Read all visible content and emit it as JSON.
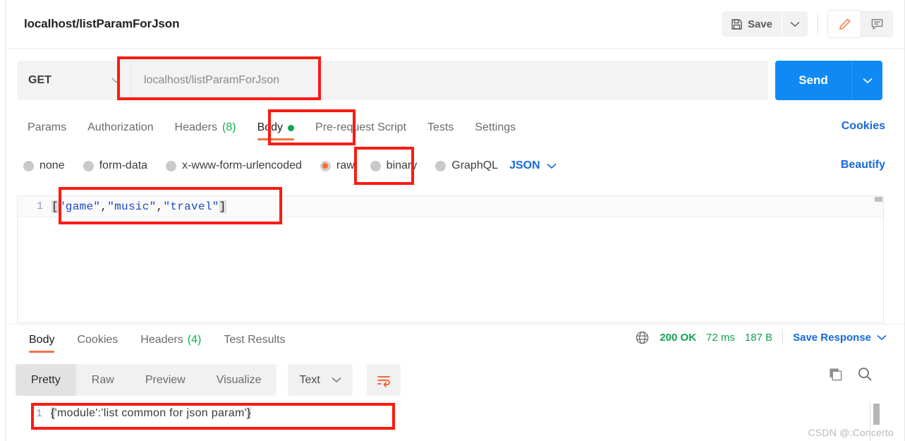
{
  "header": {
    "request_title": "localhost/listParamForJson",
    "save_label": "Save",
    "save_icon": "floppy-disk-icon",
    "save_caret_icon": "chevron-down-icon",
    "edit_icon": "pencil-icon",
    "comment_icon": "comment-icon"
  },
  "url_bar": {
    "method": "GET",
    "method_caret_icon": "chevron-down-icon",
    "url_value": "localhost/listParamForJson",
    "send_label": "Send",
    "send_caret_icon": "chevron-down-icon"
  },
  "request_tabs": {
    "items": [
      {
        "label": "Params",
        "count": "",
        "active": false
      },
      {
        "label": "Authorization",
        "count": "",
        "active": false
      },
      {
        "label": "Headers",
        "count": "(8)",
        "active": false
      },
      {
        "label": "Body",
        "count": "",
        "active": true,
        "dot": true
      },
      {
        "label": "Pre-request Script",
        "count": "",
        "active": false
      },
      {
        "label": "Tests",
        "count": "",
        "active": false
      },
      {
        "label": "Settings",
        "count": "",
        "active": false
      }
    ],
    "cookies_link": "Cookies"
  },
  "body_types": {
    "options": [
      {
        "label": "none",
        "selected": false
      },
      {
        "label": "form-data",
        "selected": false
      },
      {
        "label": "x-www-form-urlencoded",
        "selected": false
      },
      {
        "label": "raw",
        "selected": true
      },
      {
        "label": "binary",
        "selected": false
      },
      {
        "label": "GraphQL",
        "selected": false
      }
    ],
    "format": "JSON",
    "format_caret_icon": "chevron-down-icon",
    "beautify_link": "Beautify"
  },
  "request_editor": {
    "line_number": "1",
    "open_bracket": "[",
    "str1": "\"game\"",
    "comma1": ",",
    "str2": "\"music\"",
    "comma2": ",",
    "str3": "\"travel\"",
    "close_bracket": "]"
  },
  "response_tabs": {
    "items": [
      {
        "label": "Body",
        "count": "",
        "active": true
      },
      {
        "label": "Cookies",
        "count": "",
        "active": false
      },
      {
        "label": "Headers",
        "count": "(4)",
        "active": false
      },
      {
        "label": "Test Results",
        "count": "",
        "active": false
      }
    ]
  },
  "response_meta": {
    "globe_icon": "globe-icon",
    "status": "200 OK",
    "time": "72 ms",
    "size": "187 B",
    "save_response": "Save Response",
    "save_response_caret_icon": "chevron-down-icon"
  },
  "response_toolbar": {
    "views": [
      {
        "label": "Pretty",
        "active": true
      },
      {
        "label": "Raw",
        "active": false
      },
      {
        "label": "Preview",
        "active": false
      },
      {
        "label": "Visualize",
        "active": false
      }
    ],
    "format": "Text",
    "format_caret_icon": "chevron-down-icon",
    "wrap_icon": "wrap-text-icon",
    "copy_icon": "copy-icon",
    "search_icon": "search-icon"
  },
  "response_body": {
    "line_number": "1",
    "open_brace": "{",
    "content": "'module':'list common for json param'",
    "close_brace": "}"
  },
  "watermark": "CSDN @:Concerto",
  "colors": {
    "accent_orange": "#f07542",
    "link_blue": "#1668dc",
    "send_blue": "#0f8af5",
    "status_green": "#12a150",
    "annotation_red": "#fc1a11"
  }
}
